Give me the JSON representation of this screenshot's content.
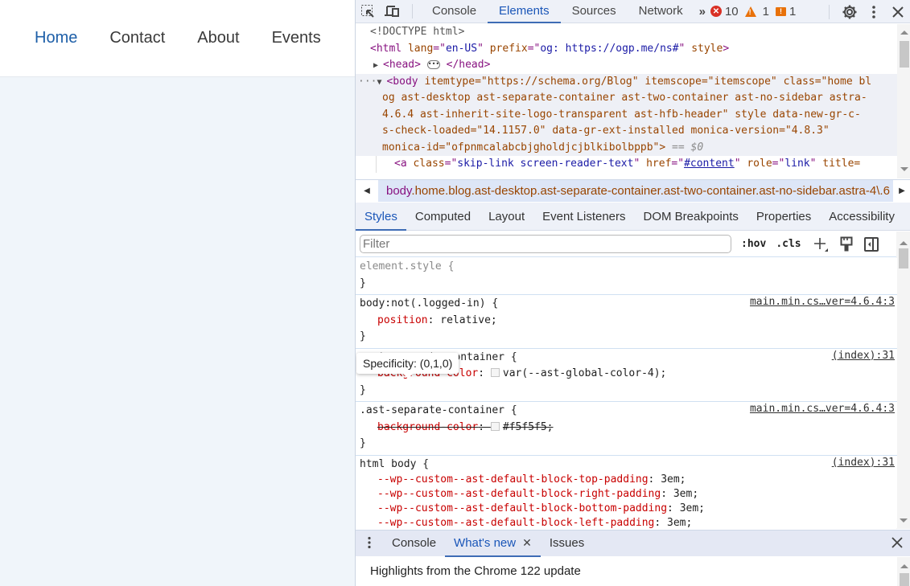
{
  "page": {
    "nav": [
      {
        "label": "Home",
        "active": true
      },
      {
        "label": "Contact",
        "active": false
      },
      {
        "label": "About",
        "active": false
      },
      {
        "label": "Events",
        "active": false
      }
    ],
    "accent_color": "#1e5fa8"
  },
  "devtools": {
    "toolbar": {
      "inspect_icon": "inspect-element-icon",
      "device_icon": "device-toolbar-icon",
      "tabs": [
        "Console",
        "Elements",
        "Sources",
        "Network"
      ],
      "active_tab": "Elements",
      "more_tabs": "»",
      "errors": "10",
      "warnings": "1",
      "issues": "1",
      "settings_icon": "gear-icon",
      "menu_icon": "kebab-menu-icon",
      "close_icon": "close-icon"
    },
    "dom": {
      "doctype": "<!DOCTYPE html>",
      "html_open": {
        "tag": "html",
        "attrs": [
          [
            "lang",
            "en-US"
          ],
          [
            "prefix",
            "og: https://ogp.me/ns#"
          ]
        ],
        "flag": "style"
      },
      "head": {
        "open": "<head>",
        "close": "</head>"
      },
      "body_lines": [
        "itemtype=\"https://schema.org/Blog\" itemscope=\"itemscope\" class=\"home bl",
        "og ast-desktop ast-separate-container ast-two-container ast-no-sidebar astra-",
        "4.6.4 ast-inherit-site-logo-transparent ast-hfb-header\" style data-new-gr-c-",
        "s-check-loaded=\"14.1157.0\" data-gr-ext-installed monica-version=\"4.8.3\"",
        "monica-id=\"ofpnmcalabcbjgholdjcjblkibolbppb\">"
      ],
      "selected_marker": "== $0",
      "child_line": {
        "tag": "a",
        "class": "skip-link screen-reader-text",
        "href": "#content",
        "role": "link",
        "tail": "title="
      }
    },
    "breadcrumb": {
      "tag": "body",
      "classes": ".home.blog.ast-desktop.ast-separate-container.ast-two-container.ast-no-sidebar.astra-4\\.6"
    },
    "subtabs": [
      "Styles",
      "Computed",
      "Layout",
      "Event Listeners",
      "DOM Breakpoints",
      "Properties",
      "Accessibility"
    ],
    "active_subtab": "Styles",
    "filter": {
      "placeholder": "Filter",
      "value": "",
      "hov": ":hov",
      "cls": ".cls"
    },
    "rules": [
      {
        "selector": "element.style {",
        "close": "}",
        "source": "",
        "props": []
      },
      {
        "selector": "body:not(.logged-in) {",
        "close": "}",
        "source": "main.min.cs…ver=4.6.4:3",
        "props": [
          {
            "name": "position",
            "value": "relative;",
            "struck": false
          }
        ]
      },
      {
        "selector": ".ast-separate-container {",
        "close": "}",
        "source": "(index):31",
        "props": [
          {
            "name": "background-color",
            "value": "var(--ast-global-color-4);",
            "struck": false,
            "swatch": "#f5f5f5"
          }
        ]
      },
      {
        "selector": ".ast-separate-container {",
        "close": "}",
        "source": "main.min.cs…ver=4.6.4:3",
        "props": [
          {
            "name": "background-color",
            "value": "#f5f5f5;",
            "struck": true,
            "swatch": "#f5f5f5"
          }
        ]
      },
      {
        "selector": "html body {",
        "close": "",
        "source": "(index):31",
        "props": [
          {
            "name": "--wp--custom--ast-default-block-top-padding",
            "value": "3em;",
            "struck": false
          },
          {
            "name": "--wp--custom--ast-default-block-right-padding",
            "value": "3em;",
            "struck": false
          },
          {
            "name": "--wp--custom--ast-default-block-bottom-padding",
            "value": "3em;",
            "struck": false
          },
          {
            "name": "--wp--custom--ast-default-block-left-padding",
            "value": "3em;",
            "struck": false
          }
        ]
      }
    ],
    "tooltip": "Specificity: (0,1,0)",
    "drawer": {
      "tabs": [
        "Console",
        "What's new",
        "Issues"
      ],
      "active_tab": "What's new",
      "content": "Highlights from the Chrome 122 update"
    }
  }
}
